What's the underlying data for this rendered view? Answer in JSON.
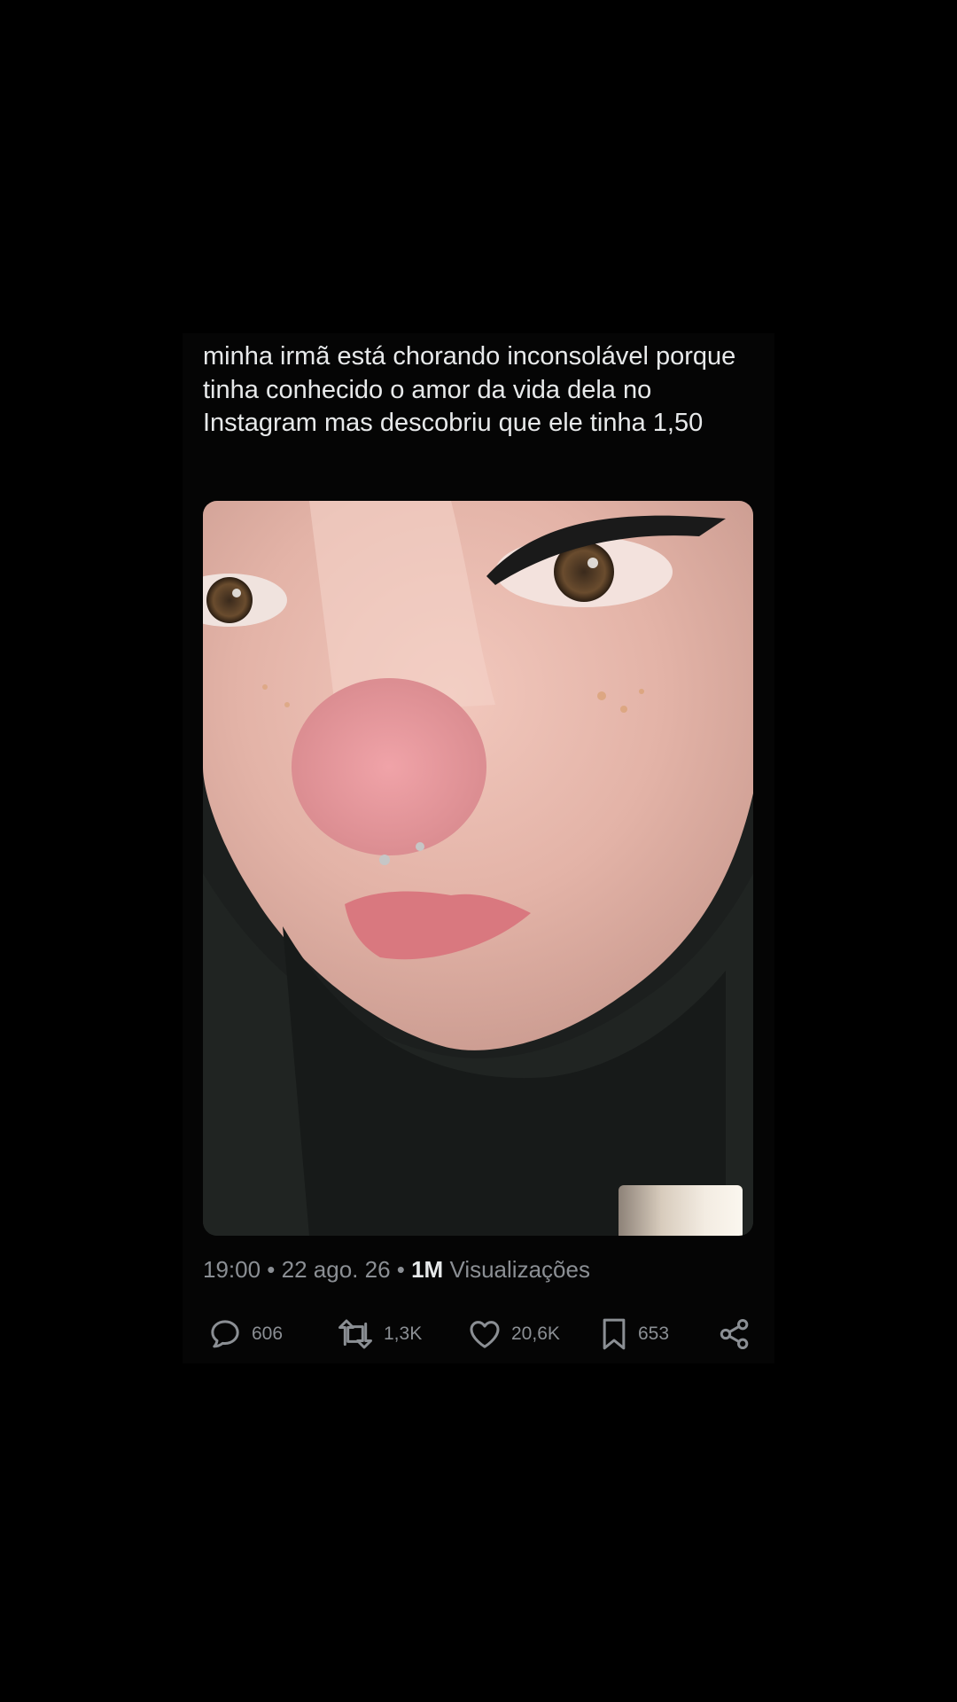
{
  "tweet": {
    "text": "minha irmã está chorando inconsolável porque tinha conhecido o amor da vida dela no Instagram mas descobriu que ele tinha 1,50",
    "media": {
      "alt": "",
      "icon": "photo"
    },
    "meta": {
      "time": "19:00",
      "sep1": " • ",
      "date": "22 ago. 26",
      "sep2": " • ",
      "views_count": "1M",
      "views_label": " Visualizações"
    },
    "actions": {
      "replies": {
        "icon": "reply-icon",
        "count": "606"
      },
      "retweets": {
        "icon": "retweet-icon",
        "count": "1,3K"
      },
      "likes": {
        "icon": "heart-icon",
        "count": "20,6K"
      },
      "bookmarks": {
        "icon": "bookmark-icon",
        "count": "653"
      },
      "share": {
        "icon": "share-icon"
      }
    }
  },
  "colors": {
    "background": "#000000",
    "card": "#050505",
    "text_primary": "#e7e9ea",
    "text_secondary": "#8b8f94"
  }
}
